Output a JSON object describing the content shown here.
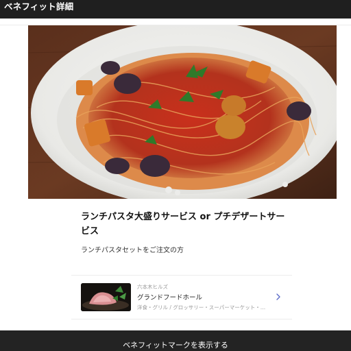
{
  "header": {
    "title": "ベネフィット詳細",
    "background": "#1f1f1f"
  },
  "hero": {
    "image": "pasta-photo",
    "description": "spaghetti with tomato sauce, eggplant and basil in a white bowl"
  },
  "benefit": {
    "title": "ランチパスタ大盛りサービス or プチデザートサービス",
    "condition": "ランチパスタセットをご注文の方"
  },
  "shop": {
    "area": "六本木ヒルズ",
    "name": "グランドフードホール",
    "categories": "洋食・グリル / グロッサリー・スーパーマーケット・…",
    "thumbnail": "meat-dish-photo",
    "chevron_icon": "chevron-right-icon",
    "chevron_color": "#5b6bc8"
  },
  "footer": {
    "button_label": "ベネフィットマークを表示する",
    "background": "#232323"
  }
}
